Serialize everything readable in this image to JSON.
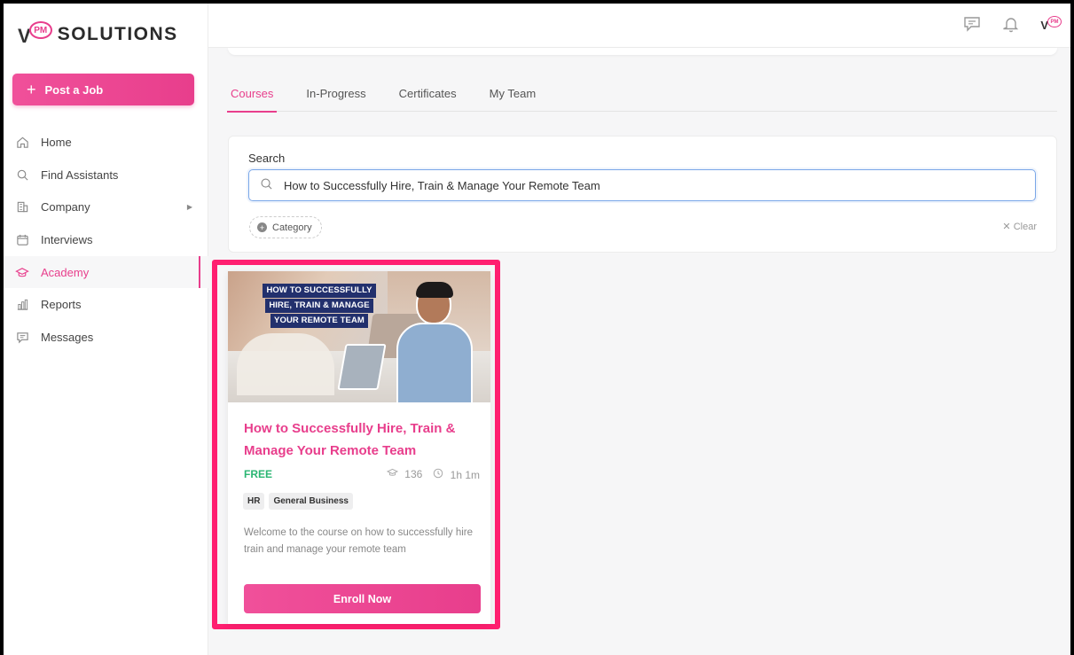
{
  "brand": {
    "logo_v": "V",
    "logo_pm": "PM",
    "logo_text": "SOLUTIONS"
  },
  "sidebar": {
    "post_job_label": "Post a Job",
    "items": [
      {
        "label": "Home",
        "icon": "home-icon"
      },
      {
        "label": "Find Assistants",
        "icon": "search-icon"
      },
      {
        "label": "Company",
        "icon": "building-icon",
        "has_submenu": true
      },
      {
        "label": "Interviews",
        "icon": "calendar-icon"
      },
      {
        "label": "Academy",
        "icon": "graduation-cap-icon",
        "active": true
      },
      {
        "label": "Reports",
        "icon": "bar-chart-icon"
      },
      {
        "label": "Messages",
        "icon": "chat-icon"
      }
    ]
  },
  "topbar": {
    "icons": [
      "chat-icon",
      "bell-icon",
      "vpm-logo"
    ]
  },
  "tabs": [
    {
      "label": "Courses",
      "active": true
    },
    {
      "label": "In-Progress"
    },
    {
      "label": "Certificates"
    },
    {
      "label": "My Team"
    }
  ],
  "search": {
    "label": "Search",
    "value": "How to Successfully Hire, Train & Manage Your Remote Team",
    "category_label": "Category",
    "clear_label": "Clear"
  },
  "course": {
    "banner_lines": [
      "HOW TO SUCCESSFULLY",
      "HIRE, TRAIN & MANAGE",
      "YOUR REMOTE TEAM"
    ],
    "title": "How to Successfully Hire, Train & Manage Your Remote Team",
    "price": "FREE",
    "enrolled": "136",
    "duration": "1h 1m",
    "tags": [
      "HR",
      "General Business"
    ],
    "description": "Welcome to the course on how to successfully hire train and manage your remote team",
    "enroll_label": "Enroll Now"
  },
  "colors": {
    "accent": "#e83e8c",
    "highlight": "#ff1f70",
    "price_green": "#2bb673",
    "focus_blue": "#7aa7e8"
  }
}
